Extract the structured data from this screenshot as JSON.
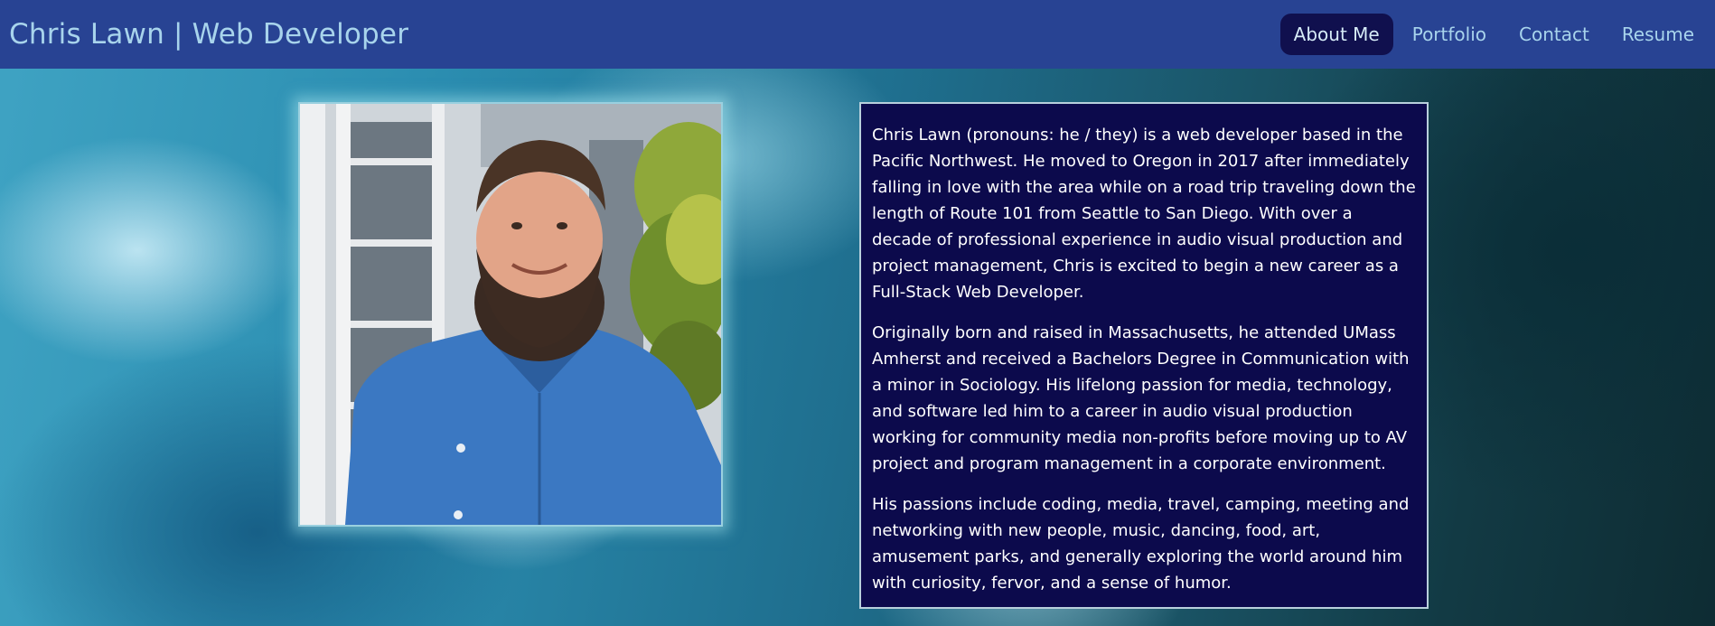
{
  "header": {
    "brand": "Chris Lawn | Web Developer",
    "nav": [
      {
        "label": "About Me",
        "active": true
      },
      {
        "label": "Portfolio",
        "active": false
      },
      {
        "label": "Contact",
        "active": false
      },
      {
        "label": "Resume",
        "active": false
      }
    ]
  },
  "colors": {
    "navbar": "#284393",
    "nav_text": "#a8d4ec",
    "active_pill": "#10104e",
    "bio_background": "#0c0a4c"
  },
  "bio": {
    "paragraphs": [
      "Chris Lawn (pronouns: he / they) is a web developer based in the Pacific Northwest. He moved to Oregon in 2017 after immediately falling in love with the area while on a road trip traveling down the length of Route 101 from Seattle to San Diego. With over a decade of professional experience in audio visual production and project management, Chris is excited to begin a new career as a Full-Stack Web Developer.",
      "Originally born and raised in Massachusetts, he attended UMass Amherst and received a Bachelors Degree in Communication with a minor in Sociology. His lifelong passion for media, technology, and software led him to a career in audio visual production working for community media non-profits before moving up to AV project and program management in a corporate environment.",
      "His passions include coding, media, travel, camping, meeting and networking with new people, music, dancing, food, art, amusement parks, and generally exploring the world around him with curiosity, fervor, and a sense of humor."
    ]
  }
}
